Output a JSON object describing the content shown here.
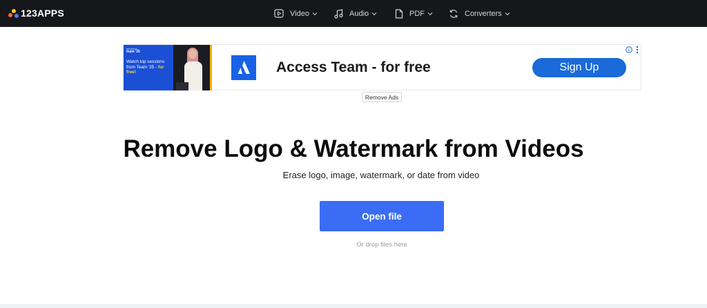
{
  "brand": {
    "name": "123APPS",
    "dot_colors": [
      "#ff6b3d",
      "#ffc629",
      "#4b7bff"
    ]
  },
  "nav": {
    "items": [
      {
        "label": "Video",
        "icon": "video-icon"
      },
      {
        "label": "Audio",
        "icon": "music-note-icon"
      },
      {
        "label": "PDF",
        "icon": "document-icon"
      },
      {
        "label": "Converters",
        "icon": "convert-icon"
      }
    ]
  },
  "ad": {
    "thumb_eyebrow": "atlassian",
    "thumb_event": "team '25",
    "thumb_caption": "Watch top sessions from Team '25 - for free!",
    "thumb_caption_main": "Watch top sessions from Team '25 - ",
    "thumb_caption_emph": "for free!",
    "headline": "Access Team - for free",
    "cta": "Sign Up",
    "remove_label": "Remove Ads",
    "brand_color": "#1862e6"
  },
  "hero": {
    "title": "Remove Logo & Watermark from Videos",
    "subtitle": "Erase logo, image, watermark, or date from video",
    "open_button": "Open file",
    "drop_hint": "Or drop files here"
  },
  "colors": {
    "topbar": "#16171a",
    "accent": "#3a6cf5"
  }
}
